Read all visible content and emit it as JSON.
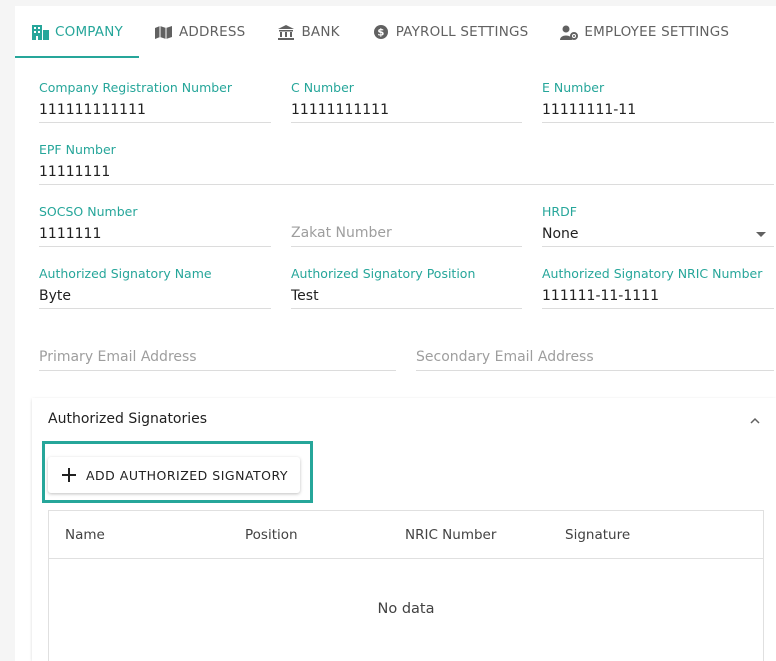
{
  "tabs": [
    {
      "label": "COMPANY",
      "icon": "company-icon",
      "active": true
    },
    {
      "label": "ADDRESS",
      "icon": "map-icon",
      "active": false
    },
    {
      "label": "BANK",
      "icon": "bank-icon",
      "active": false
    },
    {
      "label": "PAYROLL SETTINGS",
      "icon": "dollar-icon",
      "active": false
    },
    {
      "label": "EMPLOYEE SETTINGS",
      "icon": "user-cog-icon",
      "active": false
    }
  ],
  "fields": {
    "company_registration_number": {
      "label": "Company Registration Number",
      "value": "111111111111"
    },
    "c_number": {
      "label": "C Number",
      "value": "11111111111"
    },
    "e_number": {
      "label": "E Number",
      "value": "11111111-11"
    },
    "epf_number": {
      "label": "EPF Number",
      "value": "11111111"
    },
    "socso_number": {
      "label": "SOCSO Number",
      "value": "1111111"
    },
    "zakat_number": {
      "placeholder": "Zakat Number"
    },
    "hrdf": {
      "label": "HRDF",
      "value": "None"
    },
    "signatory_name": {
      "label": "Authorized Signatory Name",
      "value": "Byte"
    },
    "signatory_position": {
      "label": "Authorized Signatory Position",
      "value": "Test"
    },
    "signatory_nric": {
      "label": "Authorized Signatory NRIC Number",
      "value": "111111-11-1111"
    },
    "primary_email": {
      "placeholder": "Primary Email Address"
    },
    "secondary_email": {
      "placeholder": "Secondary Email Address"
    }
  },
  "signatories_panel": {
    "title": "Authorized Signatories",
    "add_button_label": "ADD AUTHORIZED SIGNATORY",
    "columns": [
      "Name",
      "Position",
      "NRIC Number",
      "Signature"
    ],
    "empty_text": "No data"
  },
  "colors": {
    "accent": "#26a69a",
    "text": "#212121",
    "muted": "#9e9e9e"
  }
}
